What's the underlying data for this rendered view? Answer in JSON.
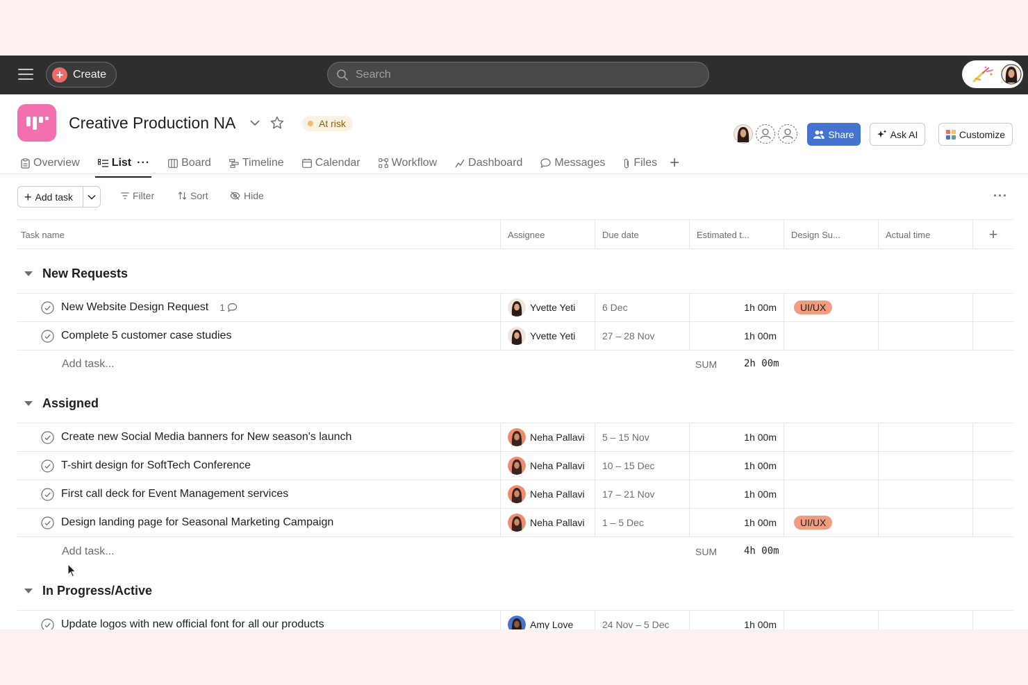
{
  "topbar": {
    "create_label": "Create",
    "search_placeholder": "Search"
  },
  "project": {
    "title": "Creative Production NA",
    "status": "At risk",
    "status_color": "#f1bd6c",
    "icon_color": "#f26fb0"
  },
  "header_buttons": {
    "share": "Share",
    "ask_ai": "Ask AI",
    "customize": "Customize"
  },
  "tabs": [
    {
      "label": "Overview",
      "icon": "overview-icon"
    },
    {
      "label": "List",
      "icon": "list-icon",
      "active": true
    },
    {
      "label": "Board",
      "icon": "board-icon"
    },
    {
      "label": "Timeline",
      "icon": "timeline-icon"
    },
    {
      "label": "Calendar",
      "icon": "calendar-icon"
    },
    {
      "label": "Workflow",
      "icon": "workflow-icon"
    },
    {
      "label": "Dashboard",
      "icon": "dashboard-icon"
    },
    {
      "label": "Messages",
      "icon": "messages-icon"
    },
    {
      "label": "Files",
      "icon": "files-icon"
    }
  ],
  "toolbar": {
    "add_task": "Add task",
    "filter": "Filter",
    "sort": "Sort",
    "hide": "Hide"
  },
  "columns": [
    "Task name",
    "Assignee",
    "Due date",
    "Estimated t...",
    "Design Su...",
    "Actual time"
  ],
  "sections": [
    {
      "title": "New Requests",
      "tasks": [
        {
          "name": "New Website Design Request",
          "comments": "1",
          "assignee": "Yvette Yeti",
          "due": "6 Dec",
          "estimate": "1h 00m",
          "tag": "UI/UX"
        },
        {
          "name": "Complete 5 customer case studies",
          "assignee": "Yvette Yeti",
          "due": "27 – 28 Nov",
          "estimate": "1h 00m"
        }
      ],
      "add_task": "Add task...",
      "sum_label": "SUM",
      "sum": "2h 00m"
    },
    {
      "title": "Assigned",
      "tasks": [
        {
          "name": "Create new Social Media banners for New season's launch",
          "assignee": "Neha Pallavi",
          "due": "5 – 15 Nov",
          "estimate": "1h 00m"
        },
        {
          "name": "T-shirt design for SoftTech Conference",
          "assignee": "Neha Pallavi",
          "due": "10 – 15 Dec",
          "estimate": "1h 00m"
        },
        {
          "name": "First call deck for Event Management services",
          "assignee": "Neha Pallavi",
          "due": "17 – 21 Nov",
          "estimate": "1h 00m"
        },
        {
          "name": "Design landing page for Seasonal Marketing Campaign",
          "assignee": "Neha Pallavi",
          "due": "1 – 5 Dec",
          "estimate": "1h 00m",
          "tag": "UI/UX"
        }
      ],
      "add_task": "Add task...",
      "sum_label": "SUM",
      "sum": "4h 00m"
    },
    {
      "title": "In Progress/Active",
      "tasks": [
        {
          "name": "Update logos with new official font for all our products",
          "assignee": "Amy Love",
          "due": "24 Nov – 5 Dec",
          "estimate": "1h 00m"
        }
      ]
    }
  ],
  "colors": {
    "topbar": "#2e2e30",
    "share": "#4573d2",
    "tag_uiux": "#f19c81",
    "page_background": "#fdf1f0"
  }
}
